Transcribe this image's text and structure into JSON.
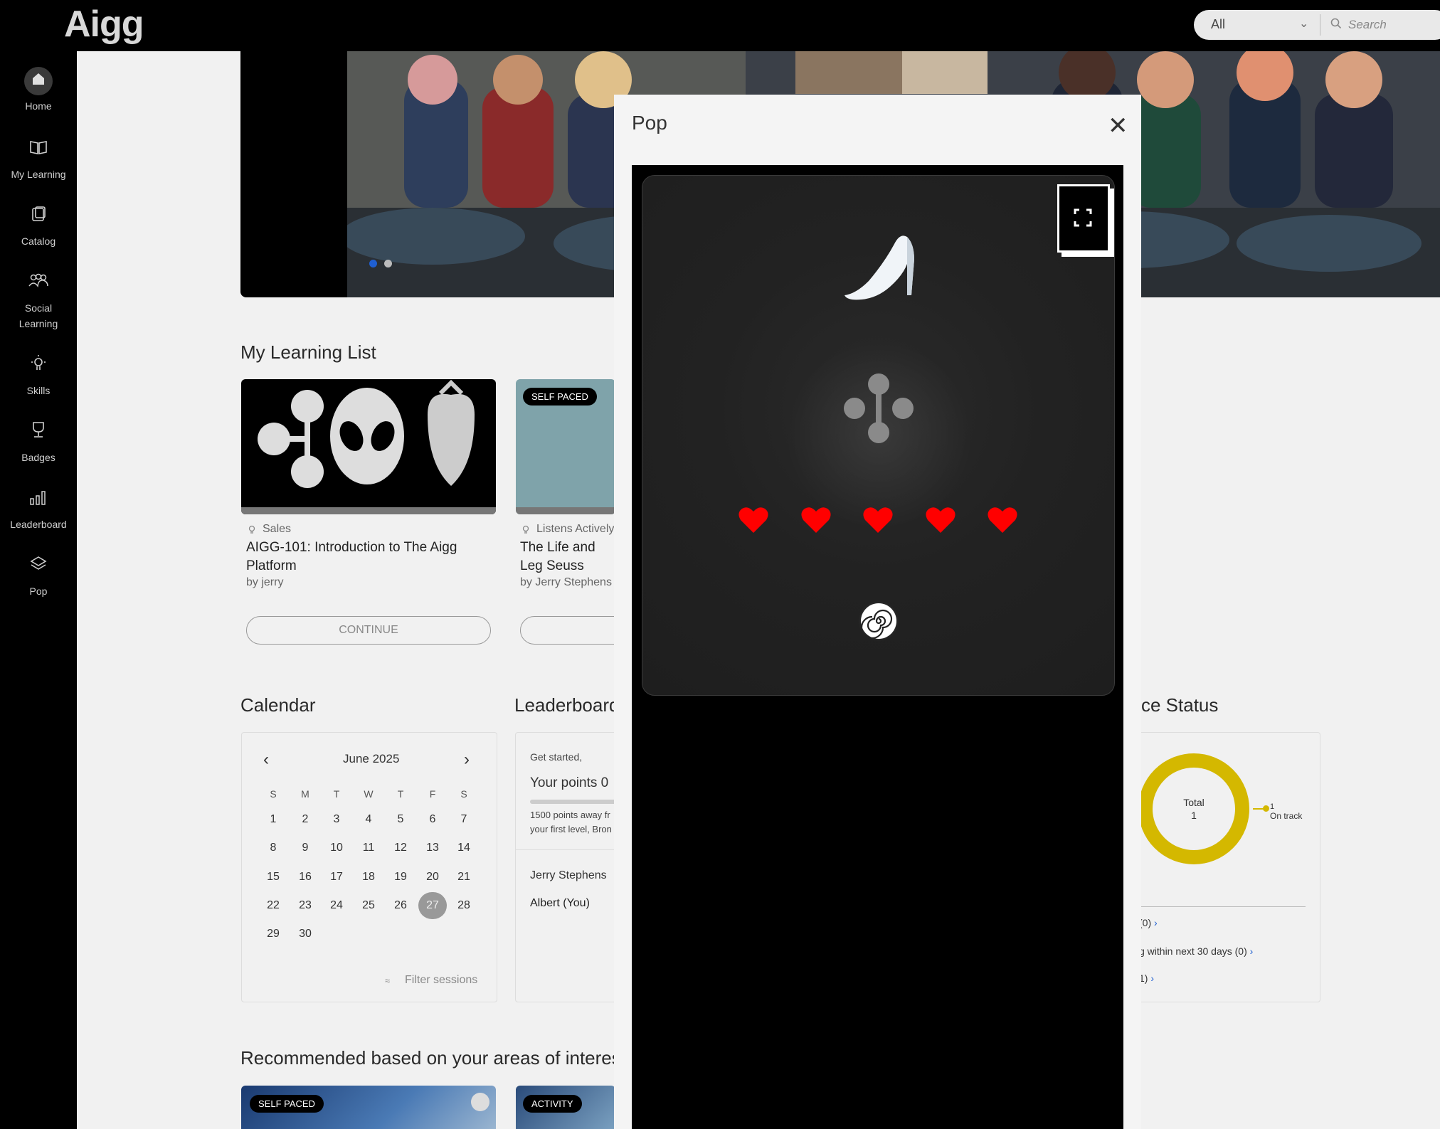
{
  "app": {
    "logo": "Aigg"
  },
  "search": {
    "scope": "All",
    "placeholder": "Search"
  },
  "sidebar": {
    "items": [
      {
        "label": "Home",
        "icon": "home-icon"
      },
      {
        "label": "My Learning",
        "icon": "book-icon"
      },
      {
        "label": "Catalog",
        "icon": "catalog-icon"
      },
      {
        "label": "Social Learning",
        "icon": "people-icon"
      },
      {
        "label": "Skills",
        "icon": "lightbulb-icon"
      },
      {
        "label": "Badges",
        "icon": "trophy-icon"
      },
      {
        "label": "Leaderboard",
        "icon": "bar-chart-icon"
      },
      {
        "label": "Pop",
        "icon": "layers-icon"
      }
    ]
  },
  "learning_list": {
    "title": "My Learning List",
    "cards": [
      {
        "skill": "Sales",
        "title": "AIGG-101: Introduction to The Aigg Platform",
        "author": "by jerry",
        "button": "CONTINUE"
      },
      {
        "badge": "SELF PACED",
        "skill": "Listens Actively",
        "title": "The Life and Leg Seuss Geisel",
        "author": "by Jerry Stephens"
      }
    ]
  },
  "calendar": {
    "title": "Calendar",
    "month": "June 2025",
    "weekdays": [
      "S",
      "M",
      "T",
      "W",
      "T",
      "F",
      "S"
    ],
    "selected_day": "27",
    "filter_label": "Filter sessions"
  },
  "leaderboard": {
    "title": "Leaderboard",
    "greeting": "Get started,",
    "points": "Your points 0",
    "note_line1": "1500 points away fr",
    "note_line2": "your first level, Bron",
    "users": [
      "Jerry Stephens",
      "Albert (You)"
    ]
  },
  "compliance": {
    "title": "ce Status",
    "total_label": "Total",
    "total_value": "1",
    "legend_value": "1",
    "legend_label": "On track",
    "link1": "(0)",
    "link2": "g within next 30 days (0)",
    "link3": "1)",
    "ring_color": "#d4b800"
  },
  "recommended": {
    "title": "Recommended based on your areas of interest",
    "badges": [
      "SELF PACED",
      "ACTIVITY"
    ]
  },
  "modal": {
    "title": "Pop",
    "game": {
      "hearts": 5,
      "heart_color": "#ff0000"
    }
  }
}
